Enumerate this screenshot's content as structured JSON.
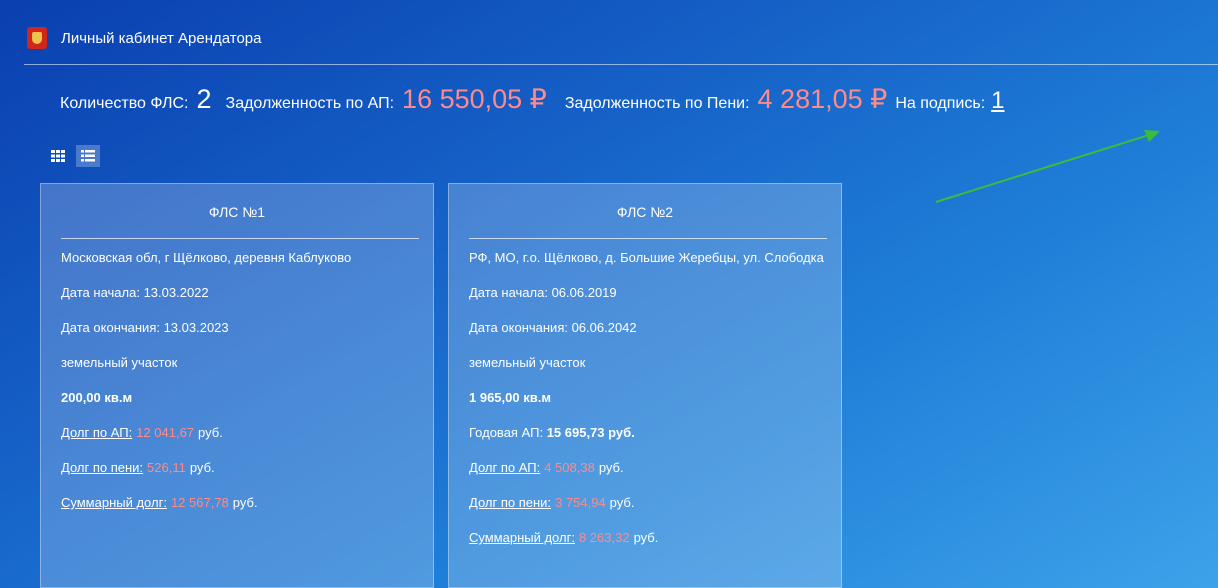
{
  "header": {
    "title": "Личный кабинет Арендатора"
  },
  "summary": {
    "fls_count_label": "Количество ФЛС:",
    "fls_count_value": "2",
    "debt_ap_label": "Задолженность по АП:",
    "debt_ap_value": "16 550,05 ₽",
    "debt_peni_label": "Задолженность по Пени:",
    "debt_peni_value": "4 281,05 ₽",
    "to_sign_label": "На подпись:",
    "to_sign_value": "1"
  },
  "view_toggle": {
    "grid_icon": "grid-icon",
    "list_icon": "list-icon"
  },
  "annotation": {
    "arrow_color": "#3cbb3c"
  },
  "cards": [
    {
      "title": "ФЛС №1",
      "address": "Московская обл, г Щёлково, деревня Каблуково",
      "start_date": "Дата начала: 13.03.2022",
      "end_date": "Дата окончания: 13.03.2023",
      "type": "земельный участок",
      "area": "200,00 кв.м",
      "debt_ap_label": "Долг по АП:",
      "debt_ap_value": "12 041,67",
      "debt_peni_label": "Долг по пени:",
      "debt_peni_value": "526,11",
      "debt_total_label": "Суммарный долг:",
      "debt_total_value": "12 567,78",
      "currency": "руб."
    },
    {
      "title": "ФЛС №2",
      "address": "РФ, МО, г.о. Щёлково, д. Большие Жеребцы, ул. Слободка",
      "start_date": "Дата начала: 06.06.2019",
      "end_date": "Дата окончания: 06.06.2042",
      "type": "земельный участок",
      "area": "1 965,00 кв.м",
      "annual_label": "Годовая АП:",
      "annual_value": "15 695,73 руб.",
      "debt_ap_label": "Долг по АП:",
      "debt_ap_value": "4 508,38",
      "debt_peni_label": "Долг по пени:",
      "debt_peni_value": "3 754,94",
      "debt_total_label": "Суммарный долг:",
      "debt_total_value": "8 263,32",
      "currency": "руб."
    }
  ]
}
